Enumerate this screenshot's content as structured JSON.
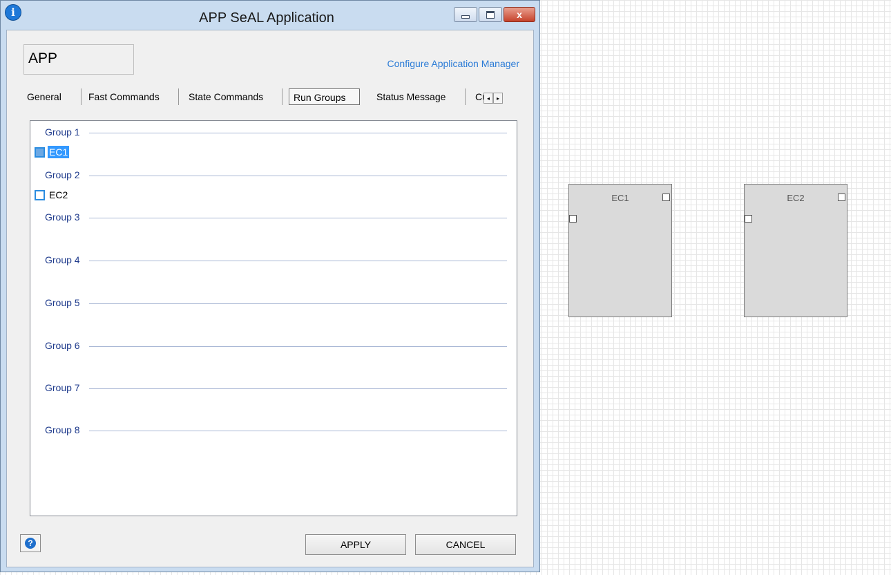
{
  "window": {
    "title": "APP SeAL Application",
    "icon": "info-icon",
    "close_glyph": "x"
  },
  "header": {
    "app_name": "APP",
    "config_link": "Configure Application Manager"
  },
  "tabs": [
    {
      "label": "General",
      "active": false
    },
    {
      "label": "Fast Commands",
      "active": false
    },
    {
      "label": "State Commands",
      "active": false
    },
    {
      "label": "Run Groups",
      "active": true
    },
    {
      "label": "Status Message",
      "active": false
    },
    {
      "label": "Cu",
      "active": false
    }
  ],
  "tab_scroll": {
    "left": "◂",
    "right": "▸"
  },
  "run_groups": {
    "groups": [
      "Group 1",
      "Group 2",
      "Group 3",
      "Group 4",
      "Group 5",
      "Group 6",
      "Group 7",
      "Group 8"
    ],
    "items": [
      {
        "label": "EC1",
        "group": "Group 1",
        "selected": true
      },
      {
        "label": "EC2",
        "group": "Group 2",
        "selected": false
      }
    ]
  },
  "footer": {
    "help": "?",
    "apply": "APPLY",
    "cancel": "CANCEL"
  },
  "canvas": {
    "blocks": [
      {
        "label": "EC1"
      },
      {
        "label": "EC2"
      }
    ]
  },
  "colors": {
    "accent": "#3399ff",
    "link": "#2b7bd6",
    "group_text": "#1f3b8c"
  }
}
